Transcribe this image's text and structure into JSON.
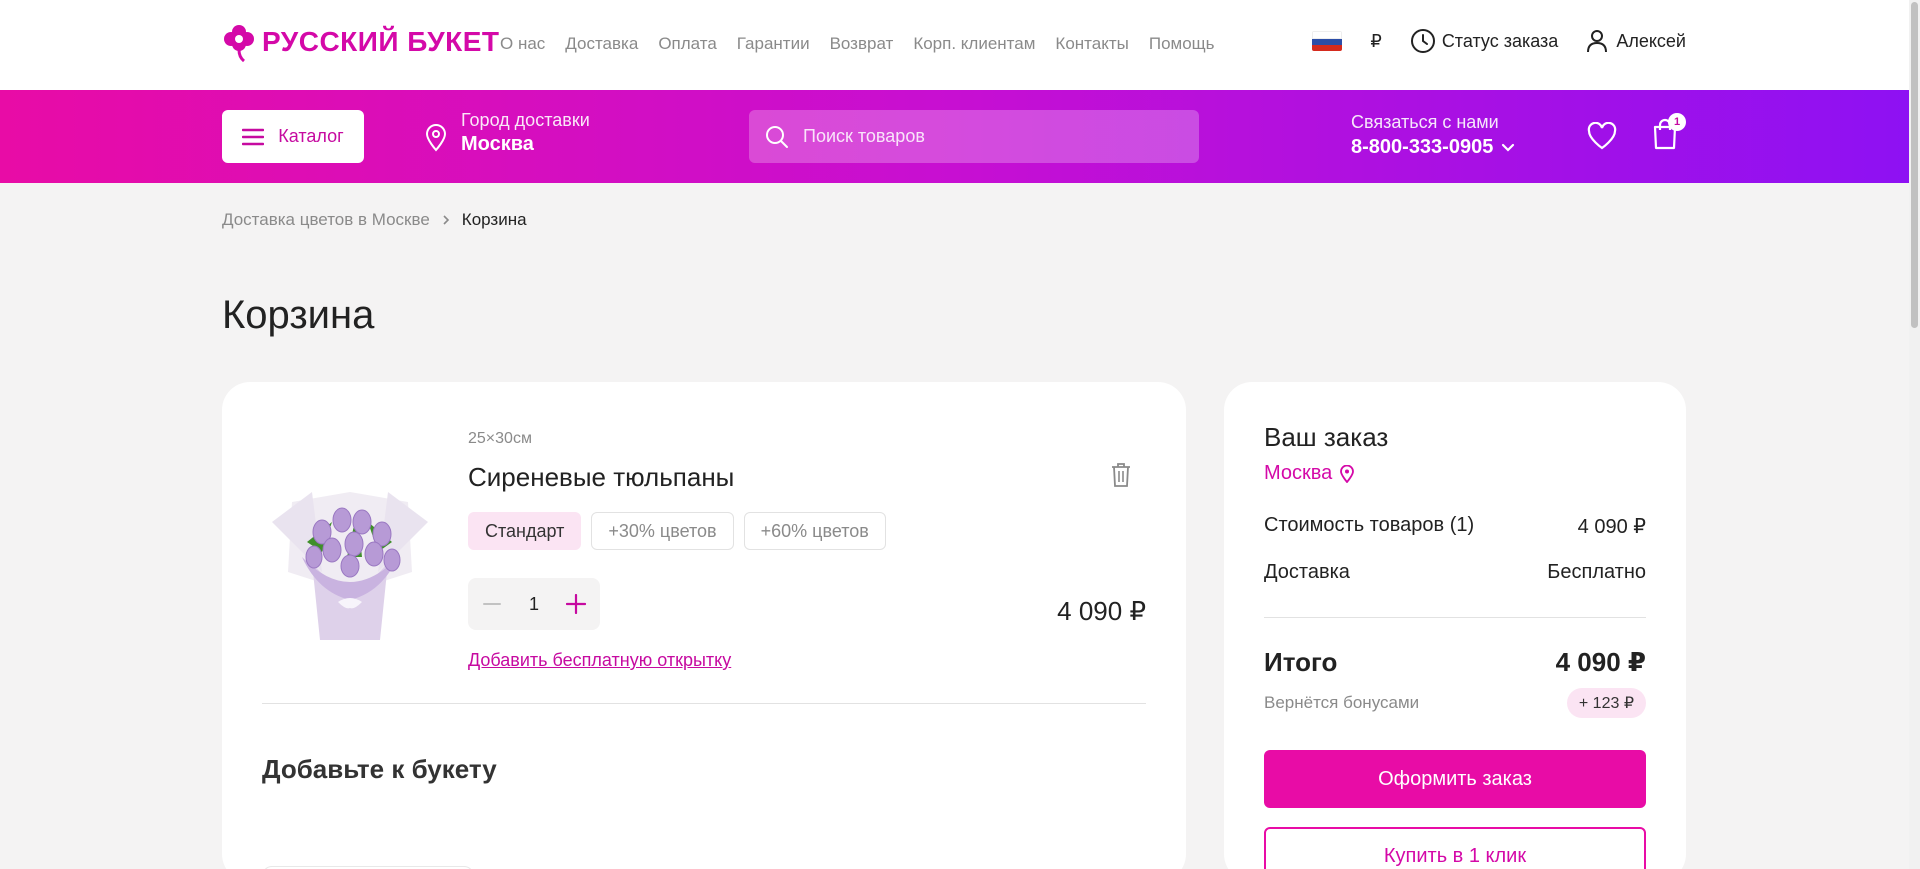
{
  "brand": {
    "name": "РУССКИЙ БУКЕТ",
    "accent": "#e80ca6"
  },
  "topnav": [
    "О нас",
    "Доставка",
    "Оплата",
    "Гарантии",
    "Возврат",
    "Корп. клиентам",
    "Контакты",
    "Помощь"
  ],
  "top_right": {
    "currency": "₽",
    "order_status": "Статус заказа",
    "user_name": "Алексей"
  },
  "header": {
    "catalog_label": "Каталог",
    "city_label": "Город доставки",
    "city_value": "Москва",
    "search_placeholder": "Поиск товаров",
    "contact_label": "Связаться с нами",
    "phone": "8-800-333-0905",
    "cart_count": "1"
  },
  "breadcrumb": {
    "parent": "Доставка цветов в Москве",
    "current": "Корзина"
  },
  "page_title": "Корзина",
  "cart_item": {
    "size": "25×30см",
    "name": "Сиреневые тюльпаны",
    "variants": [
      "Стандарт",
      "+30% цветов",
      "+60% цветов"
    ],
    "selected_variant": "Стандарт",
    "quantity": "1",
    "price": "4 090 ₽",
    "card_link": "Добавить бесплатную открытку"
  },
  "addons_title": "Добавьте к букету",
  "summary": {
    "title": "Ваш заказ",
    "city": "Москва",
    "goods_label": "Стоимость товаров (1)",
    "goods_value": "4 090 ₽",
    "delivery_label": "Доставка",
    "delivery_value": "Бесплатно",
    "total_label": "Итого",
    "total_value": "4 090 ₽",
    "bonus_label": "Вернётся бонусами",
    "bonus_value": "+ 123 ₽",
    "checkout_button": "Оформить заказ",
    "one_click_button": "Купить в 1 клик"
  }
}
